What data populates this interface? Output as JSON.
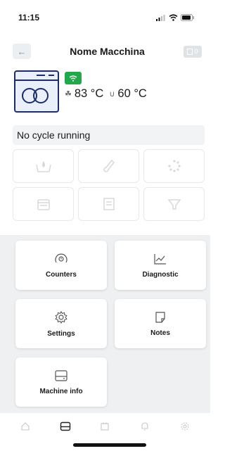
{
  "status_bar": {
    "time": "11:15"
  },
  "header": {
    "back_icon": "arrow-left-icon",
    "title": "Nome Macchina",
    "counter_value": "0"
  },
  "machine": {
    "wifi_color": "#22a84a",
    "temp_wash": "83 °C",
    "temp_rinse": "60 °C"
  },
  "cycle": {
    "status": "No cycle running"
  },
  "phase_icons": [
    "drop-basin-icon",
    "thermometer-icon",
    "spinner-icon",
    "tank-icon",
    "document-icon",
    "filter-icon"
  ],
  "menu": {
    "counters": "Counters",
    "diagnostic": "Diagnostic",
    "settings": "Settings",
    "notes": "Notes",
    "machine_info": "Machine info"
  },
  "tabbar": [
    "home-icon",
    "machine-icon",
    "calendar-icon",
    "bell-icon",
    "gear-icon"
  ]
}
